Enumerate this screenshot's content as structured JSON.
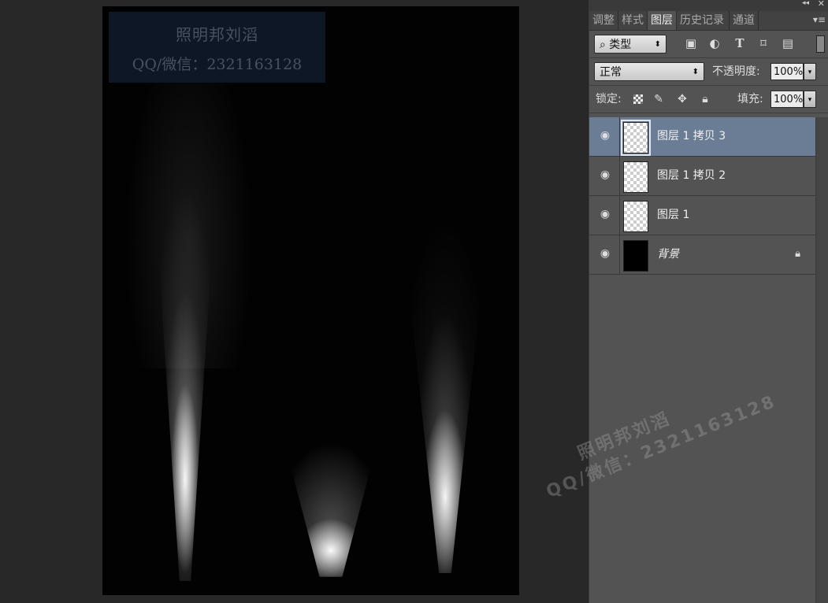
{
  "canvas": {
    "watermark_line1": "照明邦刘滔",
    "watermark_line2": "QQ/微信：2321163128"
  },
  "panel": {
    "tabs": [
      {
        "label": "调整"
      },
      {
        "label": "样式"
      },
      {
        "label": "图层"
      },
      {
        "label": "历史记录"
      },
      {
        "label": "通道"
      }
    ],
    "filter": {
      "label": "类型",
      "search_glyph": "⌕"
    },
    "blend_mode": "正常",
    "opacity_label": "不透明度:",
    "opacity_value": "100%",
    "lock_label": "锁定:",
    "fill_label": "填充:",
    "fill_value": "100%",
    "layers": [
      {
        "name": "图层 1 拷贝 3",
        "selected": true
      },
      {
        "name": "图层 1 拷贝 2"
      },
      {
        "name": "图层 1"
      },
      {
        "name": "背景",
        "locked": true
      }
    ]
  },
  "overlay_watermark": {
    "line1": "照明邦刘滔",
    "line2": "QQ/微信：2321163128"
  },
  "colors": {
    "workspace_bg": "#282828",
    "panel_bg": "#535353",
    "selected_layer": "#6b7d94"
  }
}
